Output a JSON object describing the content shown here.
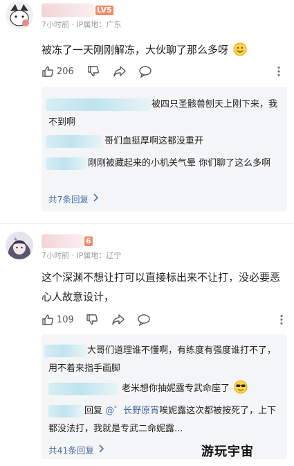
{
  "comments": [
    {
      "level_badge": "LV5",
      "meta": "7小时前 · IP属地：广东",
      "text": "被冻了一天刚刚解冻，大伙聊了那么多呀",
      "like_count": "206",
      "replies": [
        {
          "text": "被四只圣骸兽刨天上刚下来，我不到啊"
        },
        {
          "text": "哥们血挺厚啊这都没重开"
        },
        {
          "text": "刚刚被藏起来的小机关气晕 你们聊了这么多啊"
        }
      ],
      "more_replies": "共7条回复"
    },
    {
      "level_badge": "6",
      "meta": "7小时前 · IP属地：辽宁",
      "text": "这个深渊不想让打可以直接标出来不让打，没必要恶心人故意设计，",
      "like_count": "109",
      "replies": [
        {
          "text": "大哥们道理谁不懂啊，有练度有强度谁打不了，用不着来指手画脚"
        },
        {
          "text": "老米想你抽妮露专武命座了"
        },
        {
          "prefix": "回复",
          "mention": "@゜长野原宵",
          "suffix": "唉妮露这次都被按死了，上下都没法打，我就是专武二命妮露..."
        }
      ],
      "more_replies": "共41条回复"
    }
  ],
  "watermark": "游玩宇宙",
  "icons": [
    "thumbs-up-icon",
    "thumbs-down-icon",
    "share-icon",
    "comment-icon",
    "more-vertical-icon",
    "chevron-right-icon",
    "smile-emoji-icon",
    "sunglasses-emoji-icon"
  ],
  "colors": {
    "link": "#4a6fa5",
    "meta": "#9a9a9a",
    "reply_bg": "#f4f5f7",
    "badge": "#f08a6a"
  }
}
